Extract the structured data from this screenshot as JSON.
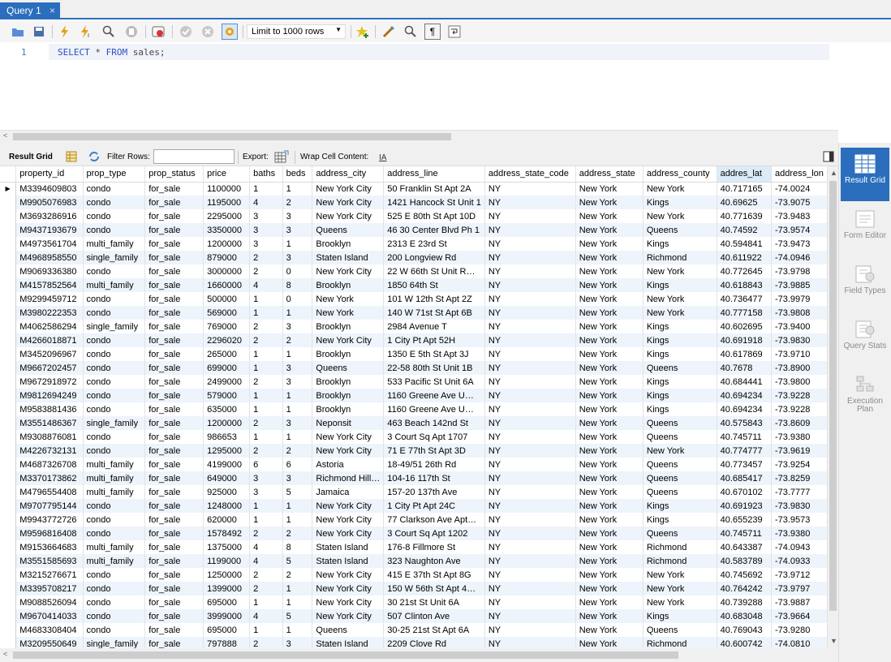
{
  "tab": {
    "title": "Query 1",
    "close": "×"
  },
  "toolbar": {
    "limit_label": "Limit to 1000 rows"
  },
  "editor": {
    "line_number": "1",
    "keyword1": "SELECT",
    "rest1": " * ",
    "keyword2": "FROM",
    "rest2": " sales;"
  },
  "results": {
    "result_grid_label": "Result Grid",
    "filter_label": "Filter Rows:",
    "export_label": "Export:",
    "wrap_label": "Wrap Cell Content:"
  },
  "side": {
    "result_grid": "Result Grid",
    "form_editor": "Form Editor",
    "field_types": "Field Types",
    "query_stats": "Query Stats",
    "execution_plan": "Execution Plan"
  },
  "columns": [
    "property_id",
    "prop_type",
    "prop_status",
    "price",
    "baths",
    "beds",
    "address_city",
    "address_line",
    "address_state_code",
    "address_state",
    "address_county",
    "addres_lat",
    "address_lon"
  ],
  "rows": [
    [
      "M3394609803",
      "condo",
      "for_sale",
      "1100000",
      "1",
      "1",
      "New York City",
      "50 Franklin St Apt 2A",
      "NY",
      "New York",
      "New York",
      "40.717165",
      "-74.0024"
    ],
    [
      "M9905076983",
      "condo",
      "for_sale",
      "1195000",
      "4",
      "2",
      "New York City",
      "1421 Hancock St Unit 1",
      "NY",
      "New York",
      "Kings",
      "40.69625",
      "-73.9075"
    ],
    [
      "M3693286916",
      "condo",
      "for_sale",
      "2295000",
      "3",
      "3",
      "New York City",
      "525 E 80th St Apt 10D",
      "NY",
      "New York",
      "New York",
      "40.771639",
      "-73.9483"
    ],
    [
      "M9437193679",
      "condo",
      "for_sale",
      "3350000",
      "3",
      "3",
      "Queens",
      "46 30 Center Blvd Ph 1",
      "NY",
      "New York",
      "Queens",
      "40.74592",
      "-73.9574"
    ],
    [
      "M4973561704",
      "multi_family",
      "for_sale",
      "1200000",
      "3",
      "1",
      "Brooklyn",
      "2313 E 23rd St",
      "NY",
      "New York",
      "Kings",
      "40.594841",
      "-73.9473"
    ],
    [
      "M4968958550",
      "single_family",
      "for_sale",
      "879000",
      "2",
      "3",
      "Staten Island",
      "200 Longview Rd",
      "NY",
      "New York",
      "Richmond",
      "40.611922",
      "-74.0946"
    ],
    [
      "M9069336380",
      "condo",
      "for_sale",
      "3000000",
      "2",
      "0",
      "New York City",
      "22 W 66th St Unit R…",
      "NY",
      "New York",
      "New York",
      "40.772645",
      "-73.9798"
    ],
    [
      "M4157852564",
      "multi_family",
      "for_sale",
      "1660000",
      "4",
      "8",
      "Brooklyn",
      "1850 64th St",
      "NY",
      "New York",
      "Kings",
      "40.618843",
      "-73.9885"
    ],
    [
      "M9299459712",
      "condo",
      "for_sale",
      "500000",
      "1",
      "0",
      "New York",
      "101 W 12th St Apt 2Z",
      "NY",
      "New York",
      "New York",
      "40.736477",
      "-73.9979"
    ],
    [
      "M3980222353",
      "condo",
      "for_sale",
      "569000",
      "1",
      "1",
      "New York",
      "140 W 71st St Apt 6B",
      "NY",
      "New York",
      "New York",
      "40.777158",
      "-73.9808"
    ],
    [
      "M4062586294",
      "single_family",
      "for_sale",
      "769000",
      "2",
      "3",
      "Brooklyn",
      "2984 Avenue T",
      "NY",
      "New York",
      "Kings",
      "40.602695",
      "-73.9400"
    ],
    [
      "M4266018871",
      "condo",
      "for_sale",
      "2296020",
      "2",
      "2",
      "New York City",
      "1 City Pt Apt 52H",
      "NY",
      "New York",
      "Kings",
      "40.691918",
      "-73.9830"
    ],
    [
      "M3452096967",
      "condo",
      "for_sale",
      "265000",
      "1",
      "1",
      "Brooklyn",
      "1350 E 5th St Apt 3J",
      "NY",
      "New York",
      "Kings",
      "40.617869",
      "-73.9710"
    ],
    [
      "M9667202457",
      "condo",
      "for_sale",
      "699000",
      "1",
      "3",
      "Queens",
      "22-58 80th St Unit 1B",
      "NY",
      "New York",
      "Queens",
      "40.7678",
      "-73.8900"
    ],
    [
      "M9672918972",
      "condo",
      "for_sale",
      "2499000",
      "2",
      "3",
      "Brooklyn",
      "533 Pacific St Unit 6A",
      "NY",
      "New York",
      "Kings",
      "40.684441",
      "-73.9800"
    ],
    [
      "M9812694249",
      "condo",
      "for_sale",
      "579000",
      "1",
      "1",
      "Brooklyn",
      "1160 Greene Ave U…",
      "NY",
      "New York",
      "Kings",
      "40.694234",
      "-73.9228"
    ],
    [
      "M9583881436",
      "condo",
      "for_sale",
      "635000",
      "1",
      "1",
      "Brooklyn",
      "1160 Greene Ave U…",
      "NY",
      "New York",
      "Kings",
      "40.694234",
      "-73.9228"
    ],
    [
      "M3551486367",
      "single_family",
      "for_sale",
      "1200000",
      "2",
      "3",
      "Neponsit",
      "463 Beach 142nd St",
      "NY",
      "New York",
      "Queens",
      "40.575843",
      "-73.8609"
    ],
    [
      "M9308876081",
      "condo",
      "for_sale",
      "986653",
      "1",
      "1",
      "New York City",
      "3 Court Sq Apt 1707",
      "NY",
      "New York",
      "Queens",
      "40.745711",
      "-73.9380"
    ],
    [
      "M4226732131",
      "condo",
      "for_sale",
      "1295000",
      "2",
      "2",
      "New York City",
      "71 E 77th St Apt 3D",
      "NY",
      "New York",
      "New York",
      "40.774777",
      "-73.9619"
    ],
    [
      "M4687326708",
      "multi_family",
      "for_sale",
      "4199000",
      "6",
      "6",
      "Astoria",
      "18-49/51 26th Rd",
      "NY",
      "New York",
      "Queens",
      "40.773457",
      "-73.9254"
    ],
    [
      "M3370173862",
      "multi_family",
      "for_sale",
      "649000",
      "3",
      "3",
      "Richmond Hill…",
      "104-16 117th St",
      "NY",
      "New York",
      "Queens",
      "40.685417",
      "-73.8259"
    ],
    [
      "M4796554408",
      "multi_family",
      "for_sale",
      "925000",
      "3",
      "5",
      "Jamaica",
      "157-20 137th Ave",
      "NY",
      "New York",
      "Queens",
      "40.670102",
      "-73.7777"
    ],
    [
      "M9707795144",
      "condo",
      "for_sale",
      "1248000",
      "1",
      "1",
      "New York City",
      "1 City Pt Apt 24C",
      "NY",
      "New York",
      "Kings",
      "40.691923",
      "-73.9830"
    ],
    [
      "M9943772726",
      "condo",
      "for_sale",
      "620000",
      "1",
      "1",
      "New York City",
      "77 Clarkson Ave Apt…",
      "NY",
      "New York",
      "Kings",
      "40.655239",
      "-73.9573"
    ],
    [
      "M9596816408",
      "condo",
      "for_sale",
      "1578492",
      "2",
      "2",
      "New York City",
      "3 Court Sq Apt 1202",
      "NY",
      "New York",
      "Queens",
      "40.745711",
      "-73.9380"
    ],
    [
      "M9153664683",
      "multi_family",
      "for_sale",
      "1375000",
      "4",
      "8",
      "Staten Island",
      "176-8 Fillmore St",
      "NY",
      "New York",
      "Richmond",
      "40.643387",
      "-74.0943"
    ],
    [
      "M3551585693",
      "multi_family",
      "for_sale",
      "1199000",
      "4",
      "5",
      "Staten Island",
      "323 Naughton Ave",
      "NY",
      "New York",
      "Richmond",
      "40.583789",
      "-74.0933"
    ],
    [
      "M3215276671",
      "condo",
      "for_sale",
      "1250000",
      "2",
      "2",
      "New York City",
      "415 E 37th St Apt 8G",
      "NY",
      "New York",
      "New York",
      "40.745692",
      "-73.9712"
    ],
    [
      "M3395708217",
      "condo",
      "for_sale",
      "1399000",
      "2",
      "1",
      "New York City",
      "150 W 56th St Apt 4…",
      "NY",
      "New York",
      "New York",
      "40.764242",
      "-73.9797"
    ],
    [
      "M9088526094",
      "condo",
      "for_sale",
      "695000",
      "1",
      "1",
      "New York City",
      "30 21st St Unit 6A",
      "NY",
      "New York",
      "New York",
      "40.739288",
      "-73.9887"
    ],
    [
      "M9670414033",
      "condo",
      "for_sale",
      "3999000",
      "4",
      "5",
      "New York City",
      "507 Clinton Ave",
      "NY",
      "New York",
      "Kings",
      "40.683048",
      "-73.9664"
    ],
    [
      "M4683308404",
      "condo",
      "for_sale",
      "695000",
      "1",
      "1",
      "Queens",
      "30-25 21st St Apt 6A",
      "NY",
      "New York",
      "Queens",
      "40.769043",
      "-73.9280"
    ],
    [
      "M3209550649",
      "single_family",
      "for_sale",
      "797888",
      "2",
      "3",
      "Staten Island",
      "2209 Clove Rd",
      "NY",
      "New York",
      "Richmond",
      "40.600742",
      "-74.0810"
    ]
  ]
}
